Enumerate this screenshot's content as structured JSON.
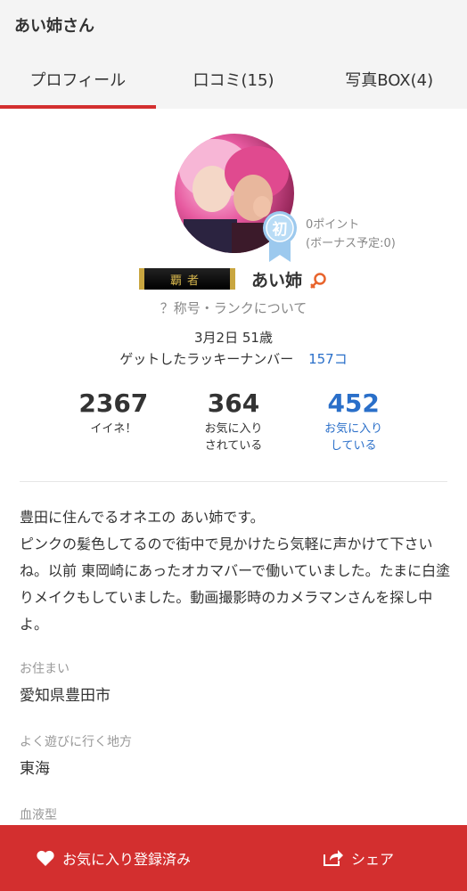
{
  "header": {
    "title": "あい姉さん"
  },
  "tabs": [
    {
      "label": "プロフィール"
    },
    {
      "label": "口コミ(15)"
    },
    {
      "label": "写真BOX(4)"
    }
  ],
  "profile": {
    "ribbon_char": "初",
    "points": "0ポイント",
    "bonus": "(ボーナス予定:0)",
    "title_badge": "覇者",
    "name": "あい姉",
    "rank_link": "？称号・ランクについて",
    "birthdate": "3月2日 51歳",
    "lucky_label": "ゲットしたラッキーナンバー",
    "lucky_value": "157コ"
  },
  "stats": [
    {
      "value": "2367",
      "label": "イイネ！"
    },
    {
      "value": "364",
      "label": "お気に入り\nされている"
    },
    {
      "value": "452",
      "label": "お気に入り\nしている"
    }
  ],
  "bio": "豊田に住んでるオネエの あい姉です。\nピンクの髪色してるので街中で見かけたら気軽に声かけて下さいね。以前 東岡崎にあったオカマバーで働いていました。たまに白塗りメイクもしていました。動画撮影時のカメラマンさんを探し中よ。",
  "fields": [
    {
      "label": "お住まい",
      "value": "愛知県豊田市"
    },
    {
      "label": "よく遊びに行く地方",
      "value": "東海"
    },
    {
      "label": "血液型",
      "value": ""
    }
  ],
  "bottom_bar": {
    "favorite_label": "お気に入り登録済み",
    "share_label": "シェア"
  },
  "colors": {
    "accent_red": "#d32f2f",
    "link_blue": "#2a6fc9",
    "badge_gold": "#c9a640"
  }
}
